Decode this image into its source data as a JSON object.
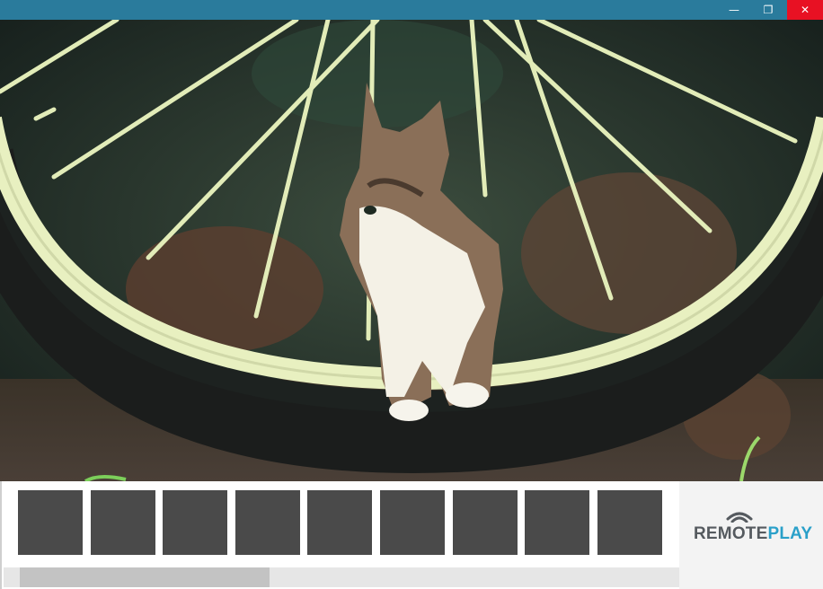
{
  "window": {
    "minimize_icon": "minimize-icon",
    "maximize_icon": "restore-icon",
    "close_icon": "close-icon",
    "titlebar_color": "#2a7b9c",
    "close_color": "#e81123",
    "minimize_glyph": "—",
    "maximize_glyph": "❐",
    "close_glyph": "✕"
  },
  "thumbnails": {
    "count": 9,
    "color": "#4a4a4a"
  },
  "scrollbar": {
    "position": 0,
    "visible_fraction": 0.37
  },
  "brand": {
    "part1": "REMOTE",
    "part2": "PLAY",
    "color1": "#555a5f",
    "color2": "#2aa0c9",
    "icon": "broadcast-icon"
  }
}
